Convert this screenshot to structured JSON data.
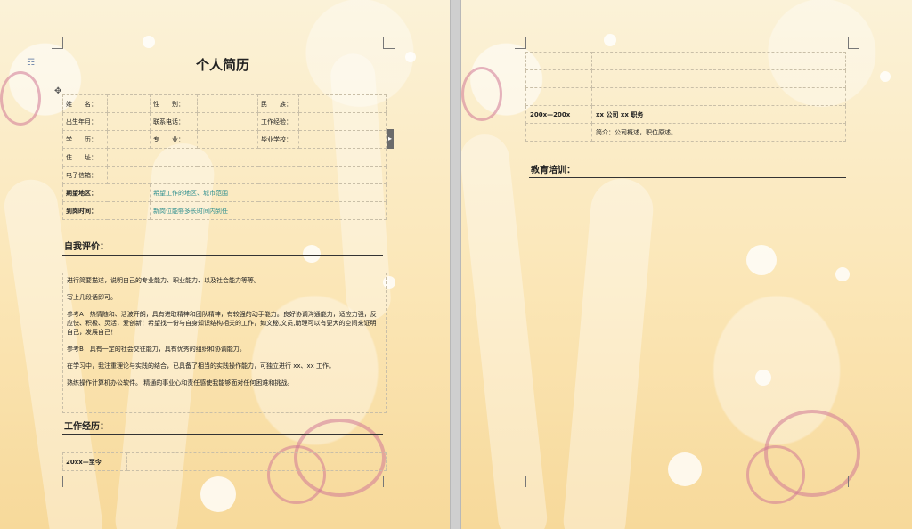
{
  "resume": {
    "title": "个人简历",
    "info_rows": [
      [
        "姓　　名：",
        "",
        "性　　别：",
        "",
        "民　　族：",
        ""
      ],
      [
        "出生年月：",
        "",
        "联系电话：",
        "",
        "工作经验：",
        ""
      ],
      [
        "学　　历：",
        "",
        "专　　业：",
        "",
        "毕业学校：",
        ""
      ]
    ],
    "address_label": "住　　址：",
    "email_label": "电子信箱：",
    "expect_area_label": "期望地区：",
    "expect_area_value": "希望工作的地区、城市范围",
    "arrival_label": "到岗时间：",
    "arrival_value": "新岗位能够多长时间内到任"
  },
  "self_eval": {
    "title": "自我评价：",
    "paragraphs": [
      "进行简要描述，说明自己的专业能力、职业能力、以及社会能力等等。",
      "写上几段话即可。",
      "参考A：热情随和、活波开朗，具有进取精神和团队精神，有较强的动手能力。良好协调沟通能力，适应力强，反应快、积极、灵活，爱创新！希望找一份与自身知识结构相关的工作，如文秘,文员,助理可以有更大的空间来证明自己，发展自己！",
      "参考B：具有一定的社会交往能力，具有优秀的组织和协调能力。",
      "在学习中，我注重理论与实践的结合，已具备了相当的实践操作能力，可独立进行 xx、xx 工作。",
      "熟练操作计算机办公软件。  精通的事业心和责任感使我能够面对任何困难和挑战。"
    ]
  },
  "work": {
    "title": "工作经历：",
    "period_left": "20xx—至今",
    "period_right": "200x—200x",
    "company": "xx 公司 xx 职务",
    "intro": "简介：公司概述，职位原述。"
  },
  "education": {
    "title": "教育培训："
  }
}
